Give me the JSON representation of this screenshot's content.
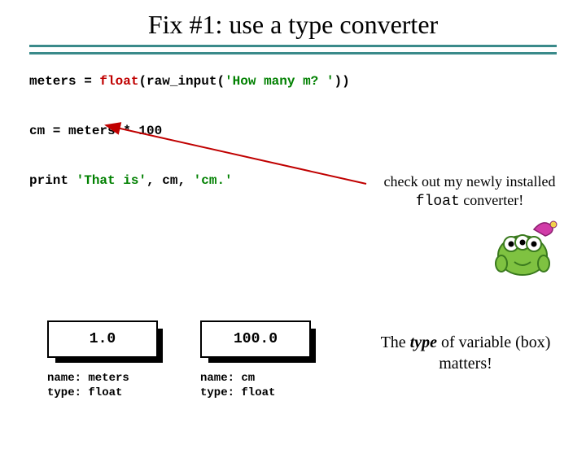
{
  "title": "Fix #1:  use a type converter",
  "code": {
    "line1_pre": "meters = ",
    "line1_float": "float",
    "line1_mid": "(raw_input(",
    "line1_str": "'How many m? '",
    "line1_post": "))",
    "line2": "cm = meters * 100",
    "line3_pre": "print ",
    "line3_str1": "'That is'",
    "line3_mid": ", cm, ",
    "line3_str2": "'cm.'"
  },
  "annotation": {
    "line1": "check out my newly installed",
    "float_word": "float",
    "line2_rest": " converter!"
  },
  "boxes": [
    {
      "value": "1.0",
      "name_label": "name: meters",
      "type_label": "type: float"
    },
    {
      "value": "100.0",
      "name_label": "name: cm",
      "type_label": "type: float"
    }
  ],
  "footer": {
    "pre": "The ",
    "em": "type",
    "post": " of variable (box) matters!"
  }
}
